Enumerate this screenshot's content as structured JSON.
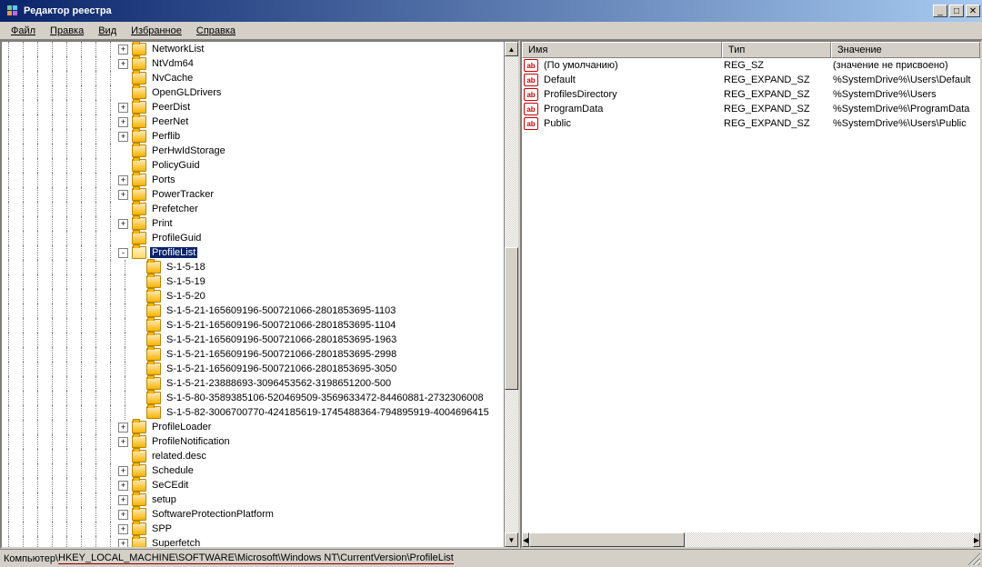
{
  "window": {
    "title": "Редактор реестра"
  },
  "menu": {
    "file": "Файл",
    "edit": "Правка",
    "view": "Вид",
    "favorites": "Избранное",
    "help": "Справка"
  },
  "tree": {
    "selected": "ProfileList",
    "nodes": [
      {
        "depth": 9,
        "exp": "+",
        "label": "NetworkList"
      },
      {
        "depth": 9,
        "exp": "+",
        "label": "NtVdm64"
      },
      {
        "depth": 9,
        "exp": "",
        "label": "NvCache"
      },
      {
        "depth": 9,
        "exp": "",
        "label": "OpenGLDrivers"
      },
      {
        "depth": 9,
        "exp": "+",
        "label": "PeerDist"
      },
      {
        "depth": 9,
        "exp": "+",
        "label": "PeerNet"
      },
      {
        "depth": 9,
        "exp": "+",
        "label": "Perflib"
      },
      {
        "depth": 9,
        "exp": "",
        "label": "PerHwIdStorage"
      },
      {
        "depth": 9,
        "exp": "",
        "label": "PolicyGuid"
      },
      {
        "depth": 9,
        "exp": "+",
        "label": "Ports"
      },
      {
        "depth": 9,
        "exp": "+",
        "label": "PowerTracker"
      },
      {
        "depth": 9,
        "exp": "",
        "label": "Prefetcher"
      },
      {
        "depth": 9,
        "exp": "+",
        "label": "Print"
      },
      {
        "depth": 9,
        "exp": "",
        "label": "ProfileGuid"
      },
      {
        "depth": 9,
        "exp": "-",
        "label": "ProfileList",
        "selected": true,
        "open": true
      },
      {
        "depth": 10,
        "exp": "",
        "label": "S-1-5-18"
      },
      {
        "depth": 10,
        "exp": "",
        "label": "S-1-5-19"
      },
      {
        "depth": 10,
        "exp": "",
        "label": "S-1-5-20"
      },
      {
        "depth": 10,
        "exp": "",
        "label": "S-1-5-21-165609196-500721066-2801853695-1103"
      },
      {
        "depth": 10,
        "exp": "",
        "label": "S-1-5-21-165609196-500721066-2801853695-1104"
      },
      {
        "depth": 10,
        "exp": "",
        "label": "S-1-5-21-165609196-500721066-2801853695-1963"
      },
      {
        "depth": 10,
        "exp": "",
        "label": "S-1-5-21-165609196-500721066-2801853695-2998"
      },
      {
        "depth": 10,
        "exp": "",
        "label": "S-1-5-21-165609196-500721066-2801853695-3050"
      },
      {
        "depth": 10,
        "exp": "",
        "label": "S-1-5-21-23888693-3096453562-3198651200-500"
      },
      {
        "depth": 10,
        "exp": "",
        "label": "S-1-5-80-3589385106-520469509-3569633472-84460881-2732306008"
      },
      {
        "depth": 10,
        "exp": "",
        "label": "S-1-5-82-3006700770-424185619-1745488364-794895919-4004696415"
      },
      {
        "depth": 9,
        "exp": "+",
        "label": "ProfileLoader"
      },
      {
        "depth": 9,
        "exp": "+",
        "label": "ProfileNotification"
      },
      {
        "depth": 9,
        "exp": "",
        "label": "related.desc"
      },
      {
        "depth": 9,
        "exp": "+",
        "label": "Schedule"
      },
      {
        "depth": 9,
        "exp": "+",
        "label": "SeCEdit"
      },
      {
        "depth": 9,
        "exp": "+",
        "label": "setup"
      },
      {
        "depth": 9,
        "exp": "+",
        "label": "SoftwareProtectionPlatform"
      },
      {
        "depth": 9,
        "exp": "+",
        "label": "SPP"
      },
      {
        "depth": 9,
        "exp": "+",
        "label": "Superfetch"
      }
    ]
  },
  "columns": {
    "name": "Имя",
    "type": "Тип",
    "value": "Значение",
    "w_name": 220,
    "w_type": 120,
    "w_value": 160
  },
  "values": [
    {
      "name": "(По умолчанию)",
      "type": "REG_SZ",
      "data": "(значение не присвоено)"
    },
    {
      "name": "Default",
      "type": "REG_EXPAND_SZ",
      "data": "%SystemDrive%\\Users\\Default"
    },
    {
      "name": "ProfilesDirectory",
      "type": "REG_EXPAND_SZ",
      "data": "%SystemDrive%\\Users"
    },
    {
      "name": "ProgramData",
      "type": "REG_EXPAND_SZ",
      "data": "%SystemDrive%\\ProgramData"
    },
    {
      "name": "Public",
      "type": "REG_EXPAND_SZ",
      "data": "%SystemDrive%\\Users\\Public"
    }
  ],
  "status": {
    "prefix": "Компьютер\\",
    "path": "HKEY_LOCAL_MACHINE\\SOFTWARE\\Microsoft\\Windows NT\\CurrentVersion\\ProfileList"
  }
}
